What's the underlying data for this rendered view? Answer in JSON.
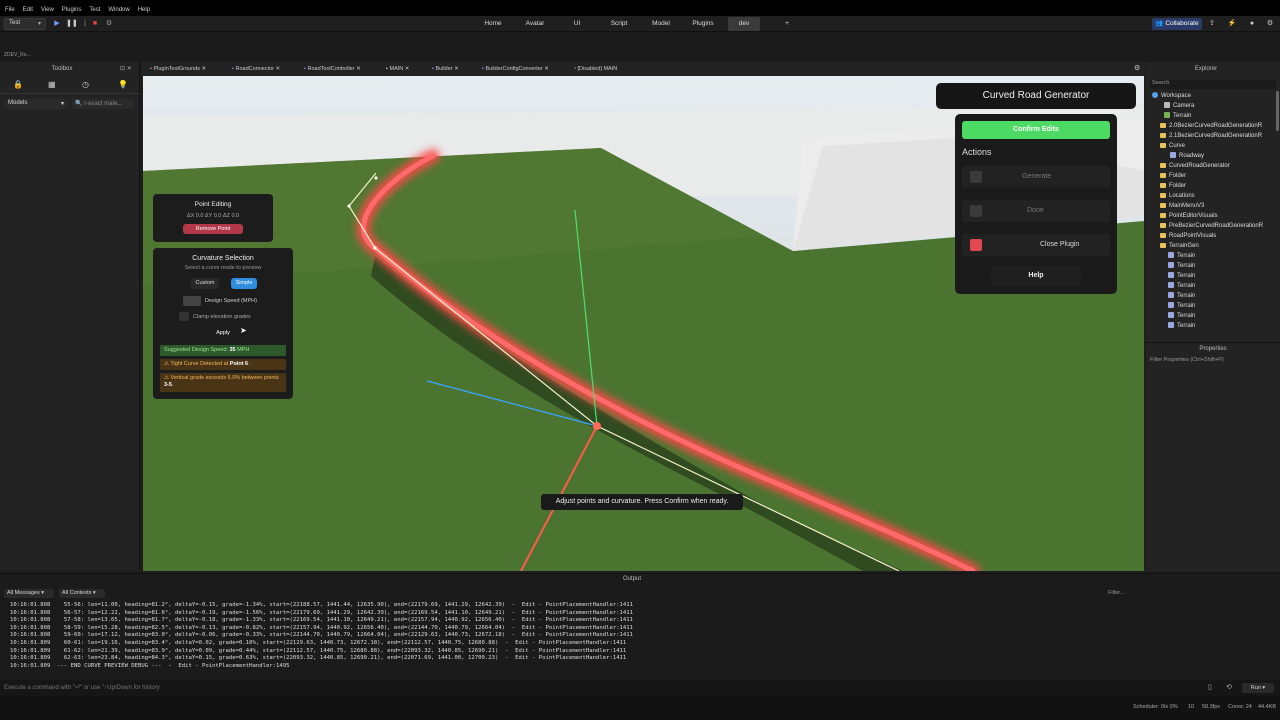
{
  "menu": [
    "File",
    "Edit",
    "View",
    "Plugins",
    "Test",
    "Window",
    "Help"
  ],
  "toolbar": {
    "game_select": "Test",
    "ribbon_tabs": [
      "Home",
      "Avatar",
      "UI",
      "Script",
      "Model",
      "Plugins",
      "dev",
      "+"
    ],
    "collaborate": "Collaborate"
  },
  "crumb": "ZDEV_Ro...",
  "toolbox": {
    "title": "Toolbox",
    "category": "Models",
    "search_placeholder": "r-exact mate..."
  },
  "tabs": [
    "PluginTestGrounds",
    "RoadConnector",
    "RoadToolController",
    "MAIN",
    "Builder",
    "BuilderConfigConverter",
    "[Disabled] MAIN"
  ],
  "explorer": {
    "title": "Explorer",
    "search_placeholder": "Search",
    "items": [
      "Workspace",
      "Camera",
      "Terrain",
      "2.0BezierCurvedRoadGenerationR",
      "2.1BezierCurvedRoadGenerationR",
      "Curve",
      "Roadway",
      "CurvedRoadGenerator",
      "Folder",
      "Folder",
      "Locations",
      "MainMenuV3",
      "PointEditorVisuals",
      "PreBezierCurvedRoadGenerationR",
      "RoadPointVisuals",
      "TerrainGen",
      "Terrain",
      "Terrain",
      "Terrain",
      "Terrain",
      "Terrain",
      "Terrain",
      "Terrain",
      "Terrain"
    ]
  },
  "properties": {
    "title": "Properties",
    "filter": "Filter Properties (Ctrl+Shift+P)"
  },
  "point_editing": {
    "title": "Point Editing",
    "delta": "ΔX 0.0  ΔY 0.0  ΔZ 0.0",
    "remove_label": "Remove Point"
  },
  "curvature": {
    "title": "Curvature Selection",
    "subtitle": "Select a curve mode to preview",
    "custom_label": "Custom",
    "simple_label": "Simple",
    "design_speed_label": "Design Speed (MPH)",
    "clamp_label": "Clamp elevation grades",
    "apply_label": "Apply",
    "suggested_prefix": "Suggested Design Speed: ",
    "suggested_value": "35",
    "suggested_unit": " MPH",
    "tight_prefix": "⚠ Tight Curve Detected at ",
    "tight_point": "Point 6",
    "tight_suffix": ".",
    "grade_prefix": "⚠ Vertical grade exceeds 6.0% between points ",
    "grade_points": "3-5",
    "grade_suffix": "."
  },
  "generator": {
    "title": "Curved Road Generator",
    "confirm_label": "Confirm Edits",
    "actions_heading": "Actions",
    "generate_label": "Generate",
    "done_label": "Done",
    "close_label": "Close Plugin",
    "help_label": "Help"
  },
  "tooltip": "Adjust points and curvature. Press Confirm when ready.",
  "output": {
    "title": "Output",
    "filter_messages": "All Messages",
    "filter_contexts": "All Contexts",
    "filter_placeholder": "Filter...",
    "lines": [
      "10:16:01.808    55-56: len=11.00, heading=81.2°, deltaY=-0.15, grade=-1.34%, start=(22188.57, 1441.44, 12635.90), end=(22179.69, 1441.29, 12642.39)  -  Edit - PointPlacementHandler:1411",
      "10:16:01.808    56-57: len=12.22, heading=81.6°, deltaY=-0.19, grade=-1.56%, start=(22179.69, 1441.29, 12642.39), end=(22169.54, 1441.10, 12649.21)  -  Edit - PointPlacementHandler:1411",
      "10:16:01.808    57-58: len=13.65, heading=81.7°, deltaY=-0.18, grade=-1.33%, start=(22169.54, 1441.10, 12649.21), end=(22157.94, 1440.92, 12656.40)  -  Edit - PointPlacementHandler:1411",
      "10:16:01.808    58-59: len=15.28, heading=82.5°, deltaY=-0.13, grade=-0.82%, start=(22157.94, 1440.92, 12656.40), end=(22144.70, 1440.79, 12664.04)  -  Edit - PointPlacementHandler:1411",
      "10:16:01.808    59-60: len=17.12, heading=83.0°, deltaY=-0.06, grade=-0.33%, start=(22144.70, 1440.79, 12664.04), end=(22129.63, 1440.73, 12672.18)  -  Edit - PointPlacementHandler:1411",
      "10:16:01.809    60-61: len=19.16, heading=83.4°, deltaY=0.02, grade=0.10%, start=(22129.63, 1440.73, 12672.18), end=(22112.57, 1440.75, 12680.88)  -  Edit - PointPlacementHandler:1411",
      "10:16:01.809    61-62: len=21.39, heading=83.9°, deltaY=0.09, grade=0.44%, start=(22112.57, 1440.75, 12680.88), end=(22093.32, 1440.85, 12690.21)  -  Edit - PointPlacementHandler:1411",
      "10:16:01.809    62-63: len=23.84, heading=84.3°, deltaY=0.15, grade=0.63%, start=(22093.32, 1440.85, 12690.21), end=(22071.69, 1441.00, 12700.23)  -  Edit - PointPlacementHandler:1411",
      "10:16:01.809  --- END CURVE PREVIEW DEBUG ---  -  Edit - PointPlacementHandler:1495"
    ]
  },
  "command_placeholder": "Execute a command with \"⏎\" or use \"↑Up/Down for history",
  "status": {
    "scheduler": "Scheduler: 0/s 0%",
    "zero": "10",
    "fps": "58.3fps",
    "cores": "Cores: 24",
    "mem": "44.4KB",
    "run_label": "Run ▾"
  },
  "colors": {
    "confirm": "#4cd964",
    "close_square": "#e0474f",
    "remove": "#b3394a",
    "simple": "#2f8de0",
    "road_glow": "#ff4a4a",
    "grass": "#4f7a33"
  }
}
